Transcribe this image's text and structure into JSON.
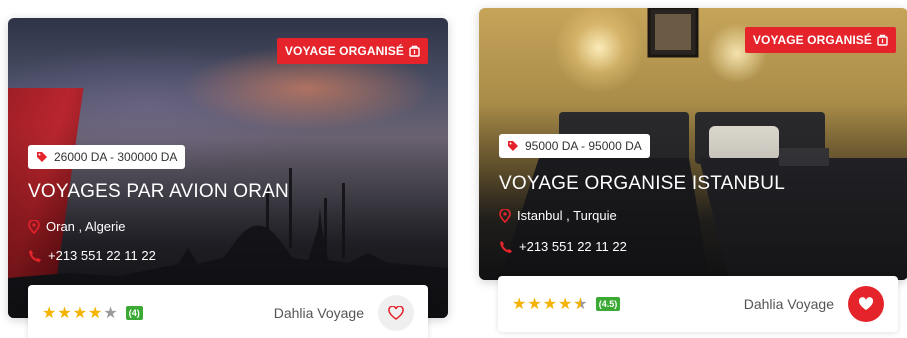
{
  "cards": [
    {
      "badge": "VOYAGE ORGANISÉ",
      "price": "26000 DA - 300000 DA",
      "title": "VOYAGES PAR AVION ORAN",
      "location": "Oran , Algerie",
      "phone": "+213 551 22 11 22",
      "rating": {
        "stars": 4,
        "score": "(4)"
      },
      "agency": "Dahlia Voyage",
      "favorite": false
    },
    {
      "badge": "VOYAGE ORGANISÉ",
      "price": "95000 DA - 95000 DA",
      "title": "VOYAGE ORGANISE ISTANBUL",
      "location": "Istanbul , Turquie",
      "phone": "+213 551 22 11 22",
      "rating": {
        "stars": 4.5,
        "score": "(4.5)"
      },
      "agency": "Dahlia Voyage",
      "favorite": true
    }
  ],
  "colors": {
    "accent_red": "#e4232b",
    "star_gold": "#f5b301",
    "score_green": "#3aaa35"
  },
  "icons": [
    "bag-icon",
    "tag-icon",
    "location-pin-icon",
    "phone-icon",
    "star-icon",
    "heart-icon"
  ]
}
